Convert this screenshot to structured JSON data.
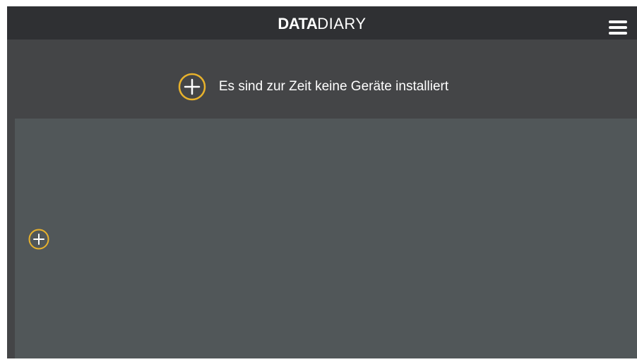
{
  "header": {
    "logo_bold": "DATA",
    "logo_light": "DIARY",
    "menu_icon": "hamburger-menu-icon"
  },
  "notice": {
    "icon": "plus-circle-icon",
    "text": "Es sind zur Zeit keine Geräte installiert"
  },
  "panel": {
    "add_icon": "plus-circle-icon"
  },
  "colors": {
    "topbar": "#2f3033",
    "background": "#444547",
    "panel": "#515759",
    "accent": "#e8b22c",
    "text": "#ffffff"
  }
}
